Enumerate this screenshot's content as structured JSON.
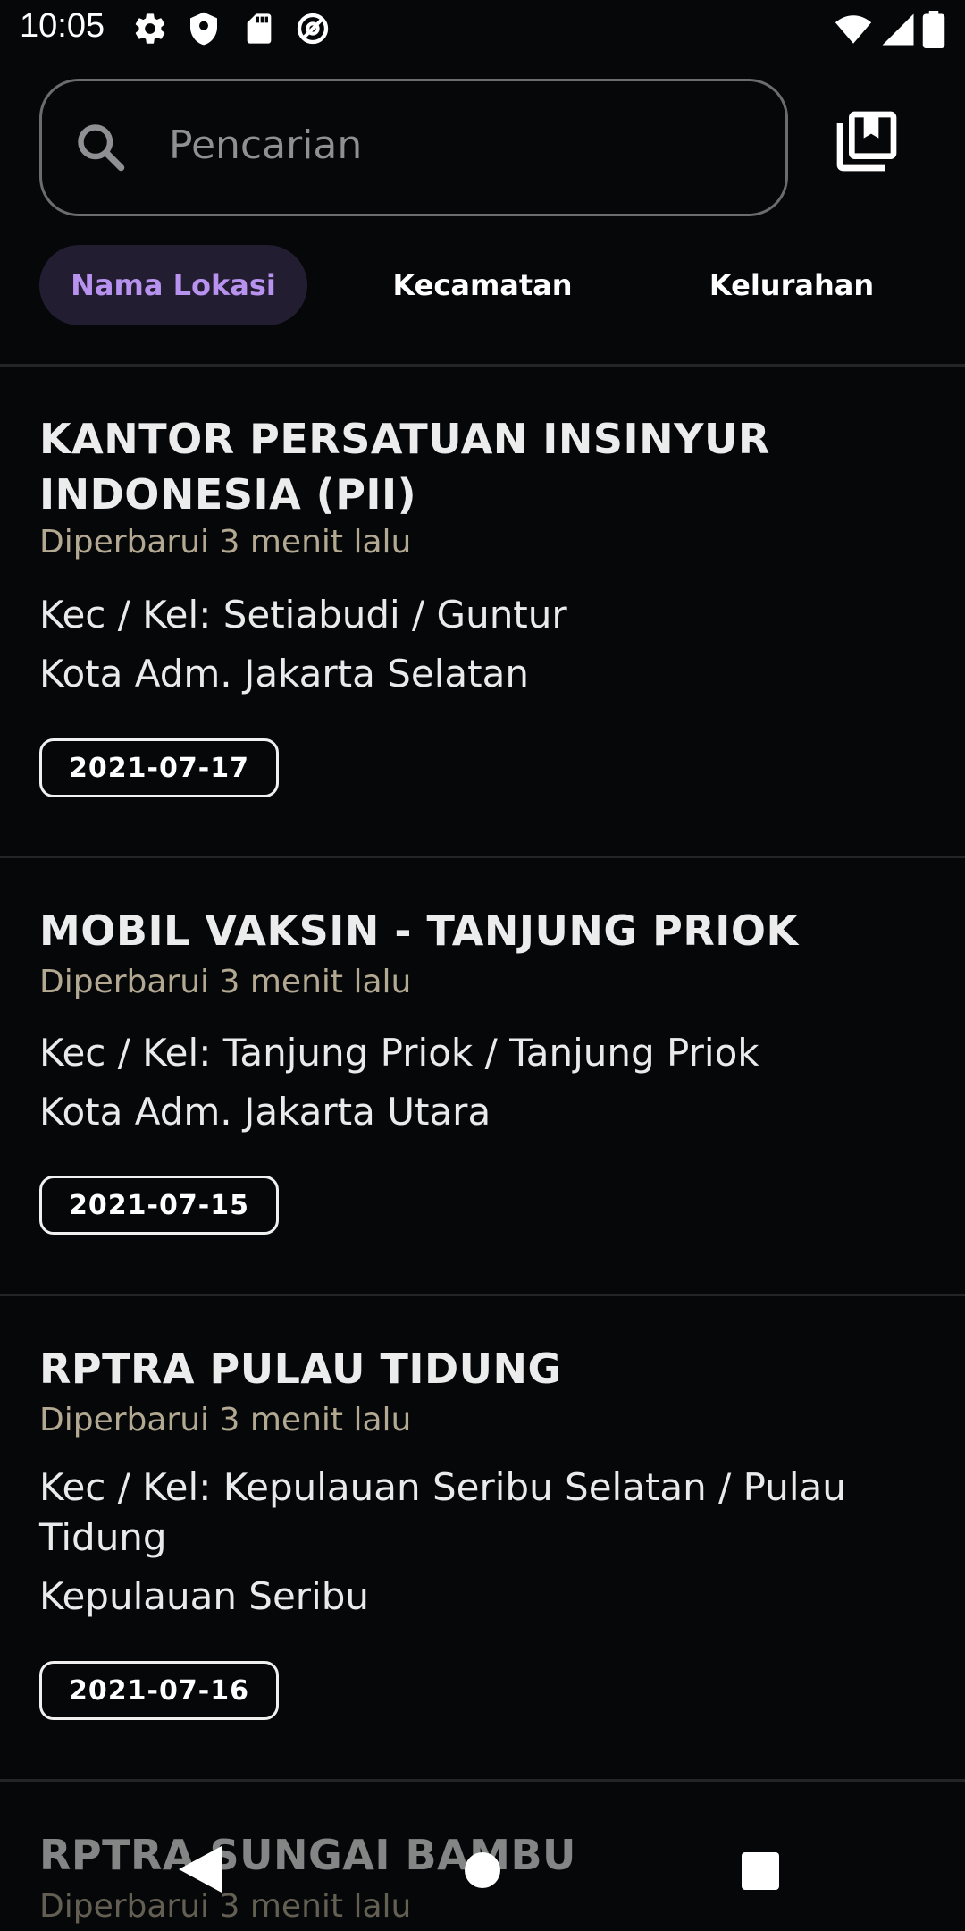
{
  "status_bar": {
    "time": "10:05"
  },
  "search": {
    "placeholder": "Pencarian"
  },
  "tabs": [
    {
      "label": "Nama Lokasi",
      "active": true
    },
    {
      "label": "Kecamatan",
      "active": false
    },
    {
      "label": "Kelurahan",
      "active": false
    }
  ],
  "cards": [
    {
      "title": "KANTOR PERSATUAN INSINYUR INDONESIA (PII)",
      "updated": "Diperbarui 3 menit lalu",
      "kec_kel": "Kec / Kel: Setiabudi / Guntur",
      "kota": "Kota Adm. Jakarta Selatan",
      "date": "2021-07-17"
    },
    {
      "title": "MOBIL VAKSIN - TANJUNG PRIOK",
      "updated": "Diperbarui 3 menit lalu",
      "kec_kel": "Kec / Kel: Tanjung Priok / Tanjung Priok",
      "kota": "Kota Adm. Jakarta Utara",
      "date": "2021-07-15"
    },
    {
      "title": "RPTRA PULAU TIDUNG",
      "updated": "Diperbarui 3 menit lalu",
      "kec_kel": "Kec / Kel: Kepulauan Seribu Selatan / Pulau Tidung",
      "kota": "Kepulauan Seribu",
      "date": "2021-07-16"
    },
    {
      "title": "RPTRA SUNGAI BAMBU",
      "updated": "Diperbarui 3 menit lalu"
    }
  ],
  "colors": {
    "accent": "#b792ee",
    "accent_bg": "#231d31",
    "updated_text": "#b3a891",
    "background": "#050708"
  }
}
